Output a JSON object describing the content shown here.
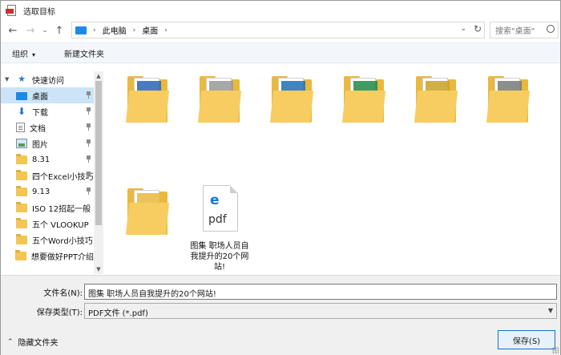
{
  "window": {
    "title": "选取目标"
  },
  "nav": {
    "back_glyph": "←",
    "forward_glyph": "→",
    "recent_glyph": "⌄",
    "up_glyph": "↑",
    "breadcrumb": [
      "此电脑",
      "桌面"
    ],
    "search_placeholder": "搜索\"桌面\""
  },
  "toolbar": {
    "organize": "组织",
    "new_folder": "新建文件夹"
  },
  "sidebar": {
    "items": [
      {
        "label": "快速访问",
        "icon": "star-icon",
        "header": true
      },
      {
        "label": "桌面",
        "icon": "desktop-icon",
        "pinned": true,
        "selected": true
      },
      {
        "label": "下载",
        "icon": "download-icon",
        "pinned": true
      },
      {
        "label": "文档",
        "icon": "document-icon",
        "pinned": true
      },
      {
        "label": "图片",
        "icon": "pictures-icon",
        "pinned": true
      },
      {
        "label": "8.31",
        "icon": "folder-icon",
        "pinned": true
      },
      {
        "label": "四个Excel小技巧",
        "icon": "folder-icon",
        "pinned": true
      },
      {
        "label": "9.13",
        "icon": "folder-icon",
        "pinned": true
      },
      {
        "label": "ISO 12招起一般",
        "icon": "folder-icon",
        "pinned": false
      },
      {
        "label": "五个 VLOOKUP",
        "icon": "folder-icon",
        "pinned": false
      },
      {
        "label": "五个Word小技巧",
        "icon": "folder-icon",
        "pinned": false
      },
      {
        "label": "想要做好PPT介绍",
        "icon": "folder-icon",
        "pinned": false
      }
    ]
  },
  "files": [
    {
      "kind": "folder",
      "caption": "",
      "accent": "#2b63b8"
    },
    {
      "kind": "folder",
      "caption": "",
      "accent": "#9a9a9a"
    },
    {
      "kind": "folder",
      "caption": "",
      "accent": "#1f6fb8"
    },
    {
      "kind": "folder",
      "caption": "",
      "accent": "#1e8a4a"
    },
    {
      "kind": "folder",
      "caption": "",
      "accent": "#c9a227"
    },
    {
      "kind": "folder",
      "caption": "",
      "accent": "#7a7a7a"
    },
    {
      "kind": "folder",
      "caption": "",
      "accent": "#e9b93f"
    },
    {
      "kind": "pdf",
      "caption": "图集   职场人员自我提升的20个网站!",
      "icon_text": "pdf"
    }
  ],
  "form": {
    "filename_label": "文件名(N):",
    "filename_value": "图集    职场人员自我提升的20个网站!",
    "filetype_label": "保存类型(T):",
    "filetype_value": "PDF文件 (*.pdf)",
    "hide_folders": "隐藏文件夹",
    "save": "保存(S)"
  },
  "colors": {
    "accent": "#1e88e5",
    "selection": "#cce4f7",
    "folder": "#f3c552"
  }
}
